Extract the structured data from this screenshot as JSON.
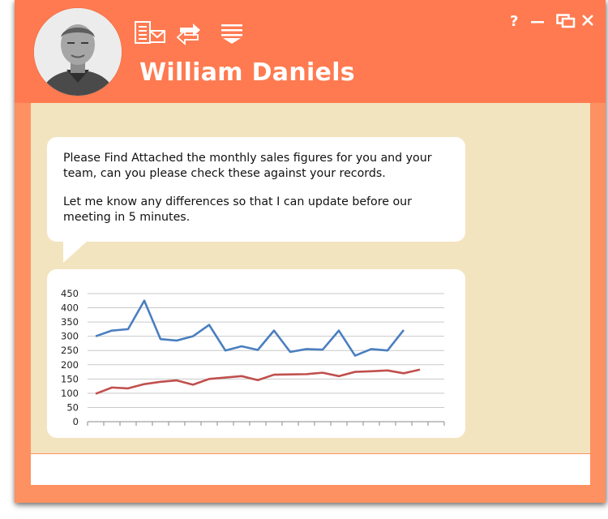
{
  "contact": {
    "name": "William Daniels"
  },
  "toolbar": {
    "icons": [
      "email-attachment-icon",
      "swap-arrows-icon",
      "menu-dropdown-icon"
    ]
  },
  "window_controls": {
    "help_label": "?",
    "icons": [
      "help-icon",
      "minimize-icon",
      "restore-icon",
      "close-icon"
    ]
  },
  "message": {
    "paragraph_1": "Please Find Attached the monthly sales figures for you and your team, can you please check these against your records.",
    "paragraph_2": "Let me know any differences so that I can update before our meeting in 5 minutes."
  },
  "colors": {
    "header": "#ff7a50",
    "frame": "#fe9161",
    "content_bg": "#f3e4c0",
    "series_1": "#4a7fc0",
    "series_2": "#c0504d"
  },
  "chart_data": {
    "type": "line",
    "ylim": [
      0,
      450
    ],
    "yticks": [
      0,
      50,
      100,
      150,
      200,
      250,
      300,
      350,
      400,
      450
    ],
    "grid": true,
    "x": [
      1,
      2,
      3,
      4,
      5,
      6,
      7,
      8,
      9,
      10,
      11,
      12,
      13,
      14,
      15,
      16,
      17,
      18,
      19,
      20,
      21,
      22
    ],
    "series": [
      {
        "values": [
          300,
          320,
          325,
          425,
          290,
          285,
          300,
          340,
          250,
          265,
          252,
          320,
          245,
          255,
          253,
          320,
          232,
          255,
          250,
          322
        ]
      },
      {
        "values": [
          98,
          120,
          117,
          132,
          140,
          145,
          130,
          150,
          155,
          160,
          146,
          165,
          166,
          167,
          172,
          160,
          175,
          177,
          180,
          170,
          183
        ]
      }
    ]
  }
}
